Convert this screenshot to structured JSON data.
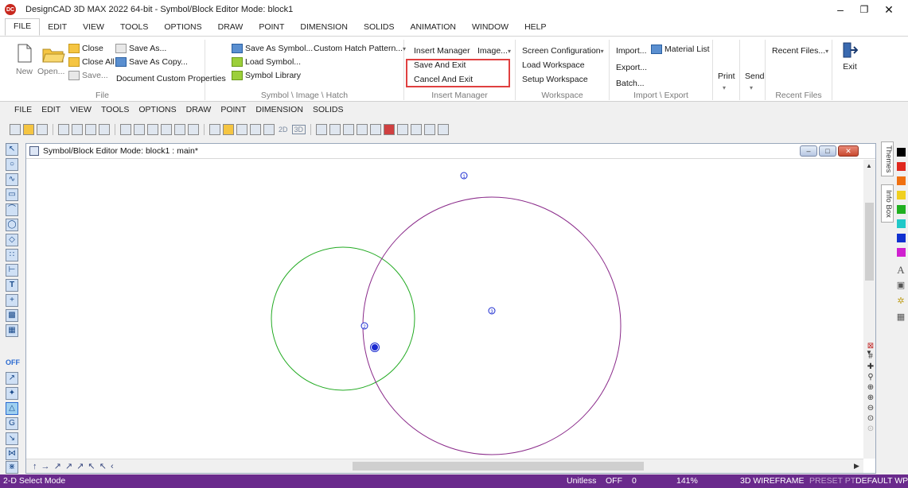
{
  "titlebar": {
    "app_logo": "DC",
    "title": "DesignCAD 3D MAX 2022 64-bit - Symbol/Block Editor Mode: block1",
    "minimize": "–",
    "restore": "❐",
    "close": "✕"
  },
  "menubar": {
    "tabs": [
      {
        "label": "FILE"
      },
      {
        "label": "EDIT"
      },
      {
        "label": "VIEW"
      },
      {
        "label": "TOOLS"
      },
      {
        "label": "OPTIONS"
      },
      {
        "label": "DRAW"
      },
      {
        "label": "POINT"
      },
      {
        "label": "DIMENSION"
      },
      {
        "label": "SOLIDS"
      },
      {
        "label": "ANIMATION"
      },
      {
        "label": "WINDOW"
      },
      {
        "label": "HELP"
      }
    ]
  },
  "ribbon": {
    "file_group": {
      "new": "New",
      "open": "Open...",
      "close": "Close",
      "close_all": "Close All",
      "save": "Save...",
      "save_as": "Save As...",
      "save_as_copy": "Save As Copy...",
      "doc_custom_props": "Document Custom Properties",
      "label": "File"
    },
    "symbol_group": {
      "save_as_symbol": "Save As Symbol...",
      "load_symbol": "Load Symbol...",
      "symbol_library": "Symbol Library",
      "custom_hatch": "Custom Hatch Pattern...",
      "label": "Symbol \\ Image \\ Hatch"
    },
    "insert_group": {
      "insert_manager": "Insert Manager",
      "image": "Image...",
      "save_and_exit": "Save And Exit",
      "cancel_and_exit": "Cancel And Exit",
      "label": "Insert Manager"
    },
    "workspace_group": {
      "screen_config": "Screen Configuration",
      "load_workspace": "Load Workspace",
      "setup_workspace": "Setup Workspace",
      "label": "Workspace"
    },
    "import_group": {
      "import": "Import...",
      "material_list": "Material List",
      "export": "Export...",
      "batch": "Batch...",
      "label": "Import \\ Export"
    },
    "print": "Print",
    "send": "Send",
    "recent_files_btn": "Recent Files...",
    "recent_files_label": "Recent Files",
    "exit": "Exit"
  },
  "secondary_menu": [
    "FILE",
    "EDIT",
    "VIEW",
    "TOOLS",
    "OPTIONS",
    "DRAW",
    "POINT",
    "DIMENSION",
    "SOLIDS"
  ],
  "toolbar_text": {
    "btn_2d": "2D",
    "btn_3d": "3D"
  },
  "left_toolbar": {
    "off_label": "OFF"
  },
  "document": {
    "title": "Symbol/Block Editor Mode: block1 : main*",
    "snap_arrows": "↑ → ↗ ↗ ↗ ↖ ↖ ‹",
    "point_labels": [
      "1",
      "2",
      "3"
    ]
  },
  "right_panel": {
    "themes_tab": "Themes",
    "info_box_tab": "Info Box",
    "palette": [
      "#000000",
      "#e0281e",
      "#f07010",
      "#f0d020",
      "#20b020",
      "#20c8c8",
      "#1030d0",
      "#d020d0"
    ]
  },
  "statusbar": {
    "mode": "2-D Select Mode",
    "units": "Unitless",
    "off": "OFF",
    "zero": "0",
    "zoom": "141%",
    "render": "3D WIREFRAME",
    "preset": "PRESET PT",
    "workplane": "DEFAULT WP"
  },
  "colors": {
    "status_bar": "#6a2a8c",
    "highlight": "#e04040",
    "green_circle": "#22aa22",
    "purple_circle": "#8a2a8a",
    "point_marker": "#1a2ad0"
  }
}
